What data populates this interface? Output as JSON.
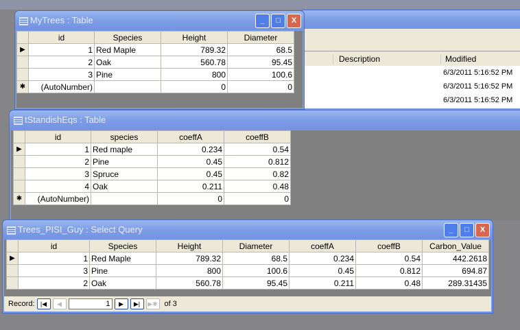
{
  "db_window": {
    "columns": [
      "Description",
      "Modified"
    ],
    "rows": [
      "6/3/2011 5:16:52 PM",
      "6/3/2011 5:16:52 PM",
      "6/3/2011 5:16:52 PM"
    ]
  },
  "mytrees": {
    "title": "MyTrees : Table",
    "headers": [
      "id",
      "Species",
      "Height",
      "Diameter"
    ],
    "rows": [
      [
        "1",
        "Red Maple",
        "789.32",
        "68.5"
      ],
      [
        "2",
        "Oak",
        "560.78",
        "95.45"
      ],
      [
        "3",
        "Pine",
        "800",
        "100.6"
      ]
    ],
    "new_row": [
      "(AutoNumber)",
      "",
      "0",
      "0"
    ]
  },
  "standish": {
    "title": "tStandishEqs : Table",
    "headers": [
      "id",
      "species",
      "coeffA",
      "coeffB"
    ],
    "rows": [
      [
        "1",
        "Red maple",
        "0.234",
        "0.54"
      ],
      [
        "2",
        "Pine",
        "0.45",
        "0.812"
      ],
      [
        "3",
        "Spruce",
        "0.45",
        "0.82"
      ],
      [
        "4",
        "Oak",
        "0.211",
        "0.48"
      ]
    ],
    "new_row": [
      "(AutoNumber)",
      "",
      "0",
      "0"
    ]
  },
  "query": {
    "title": "Trees_PISI_Guy : Select Query",
    "headers": [
      "id",
      "Species",
      "Height",
      "Diameter",
      "coeffA",
      "coeffB",
      "Carbon_Value"
    ],
    "rows": [
      [
        "1",
        "Red Maple",
        "789.32",
        "68.5",
        "0.234",
        "0.54",
        "442.2618"
      ],
      [
        "3",
        "Pine",
        "800",
        "100.6",
        "0.45",
        "0.812",
        "694.87"
      ],
      [
        "2",
        "Oak",
        "560.78",
        "95.45",
        "0.211",
        "0.48",
        "289.31435"
      ]
    ],
    "record_label": "Record:",
    "record_value": "1",
    "record_of": "of 3"
  },
  "window_buttons": {
    "minimize": "_",
    "maximize": "□",
    "close": "X"
  },
  "row_markers": {
    "current": "▶",
    "new": "✱"
  }
}
